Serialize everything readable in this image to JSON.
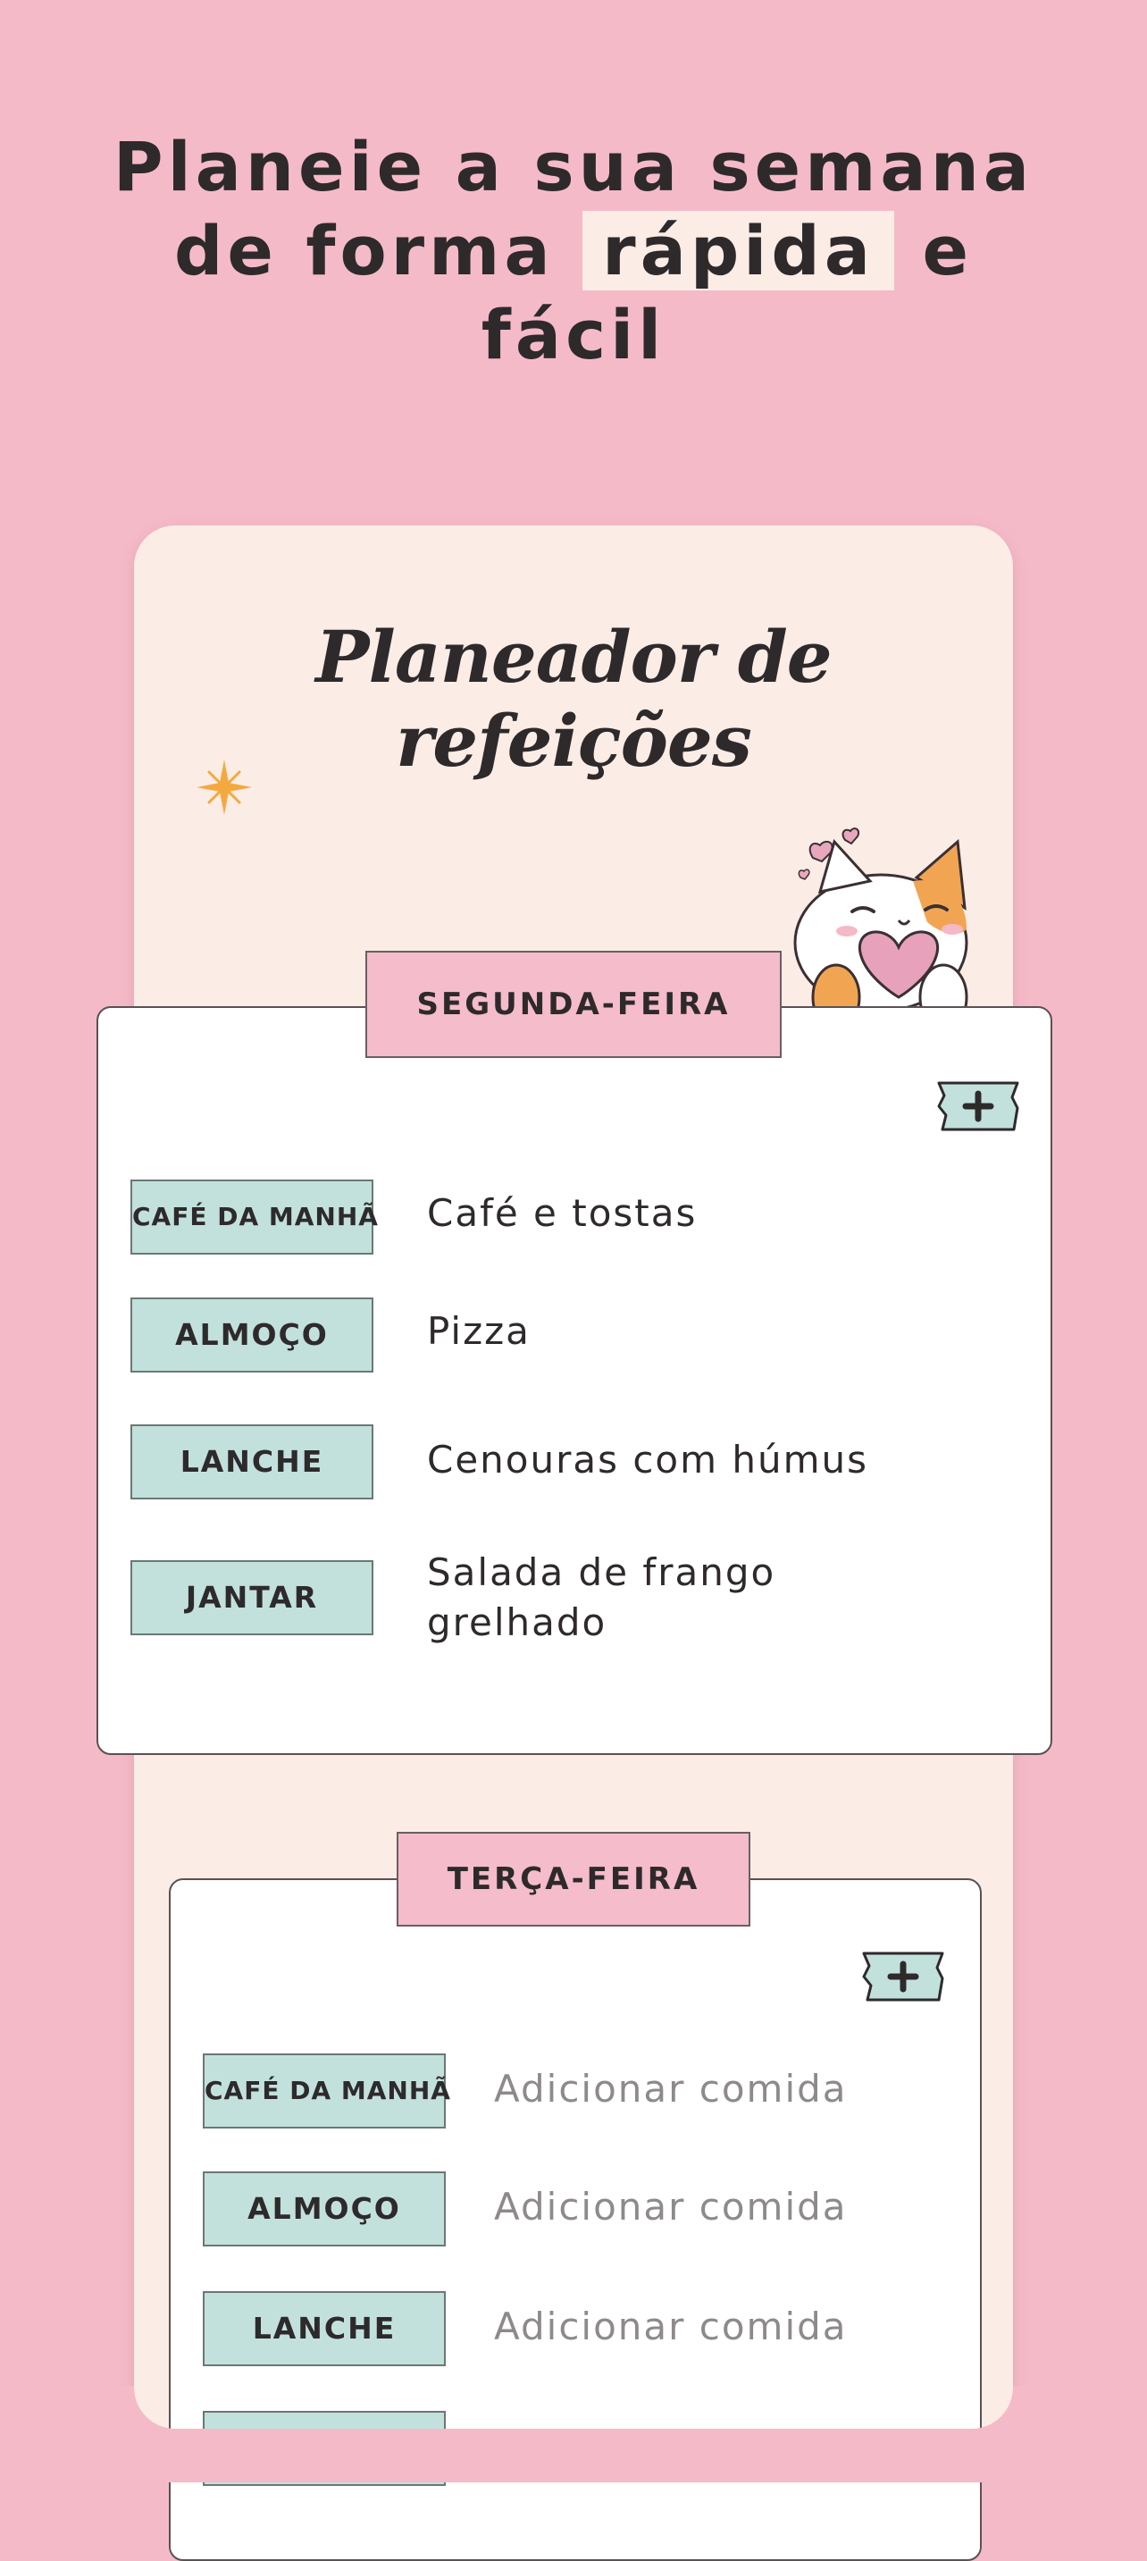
{
  "headline": {
    "line1": "Planeie a sua semana",
    "line2_pre": "de forma",
    "line2_highlight": "rápida",
    "line2_post": "e",
    "line3": "fácil"
  },
  "app": {
    "title": "Planeador de refeições"
  },
  "days": [
    {
      "name": "SEGUNDA-FEIRA",
      "meals": [
        {
          "tag": "CAFÉ DA MANHÃ",
          "food": "Café e tostas"
        },
        {
          "tag": "ALMOÇO",
          "food": "Pizza"
        },
        {
          "tag": "LANCHE",
          "food": "Cenouras com húmus"
        },
        {
          "tag": "JANTAR",
          "food": "Salada de frango grelhado"
        }
      ]
    },
    {
      "name": "TERÇA-FEIRA",
      "meals": [
        {
          "tag": "CAFÉ DA MANHÃ",
          "placeholder": "Adicionar comida"
        },
        {
          "tag": "ALMOÇO",
          "placeholder": "Adicionar comida"
        },
        {
          "tag": "LANCHE",
          "placeholder": "Adicionar comida"
        }
      ]
    }
  ],
  "icons": {
    "add": "plus-icon",
    "sparkle": "sparkle-icon",
    "mascot": "cat-heart-illustration"
  },
  "colors": {
    "background": "#f5bac8",
    "panel": "#fbece6",
    "tag_mint": "#c2e1dc",
    "tab_pink": "#f5bccb"
  }
}
